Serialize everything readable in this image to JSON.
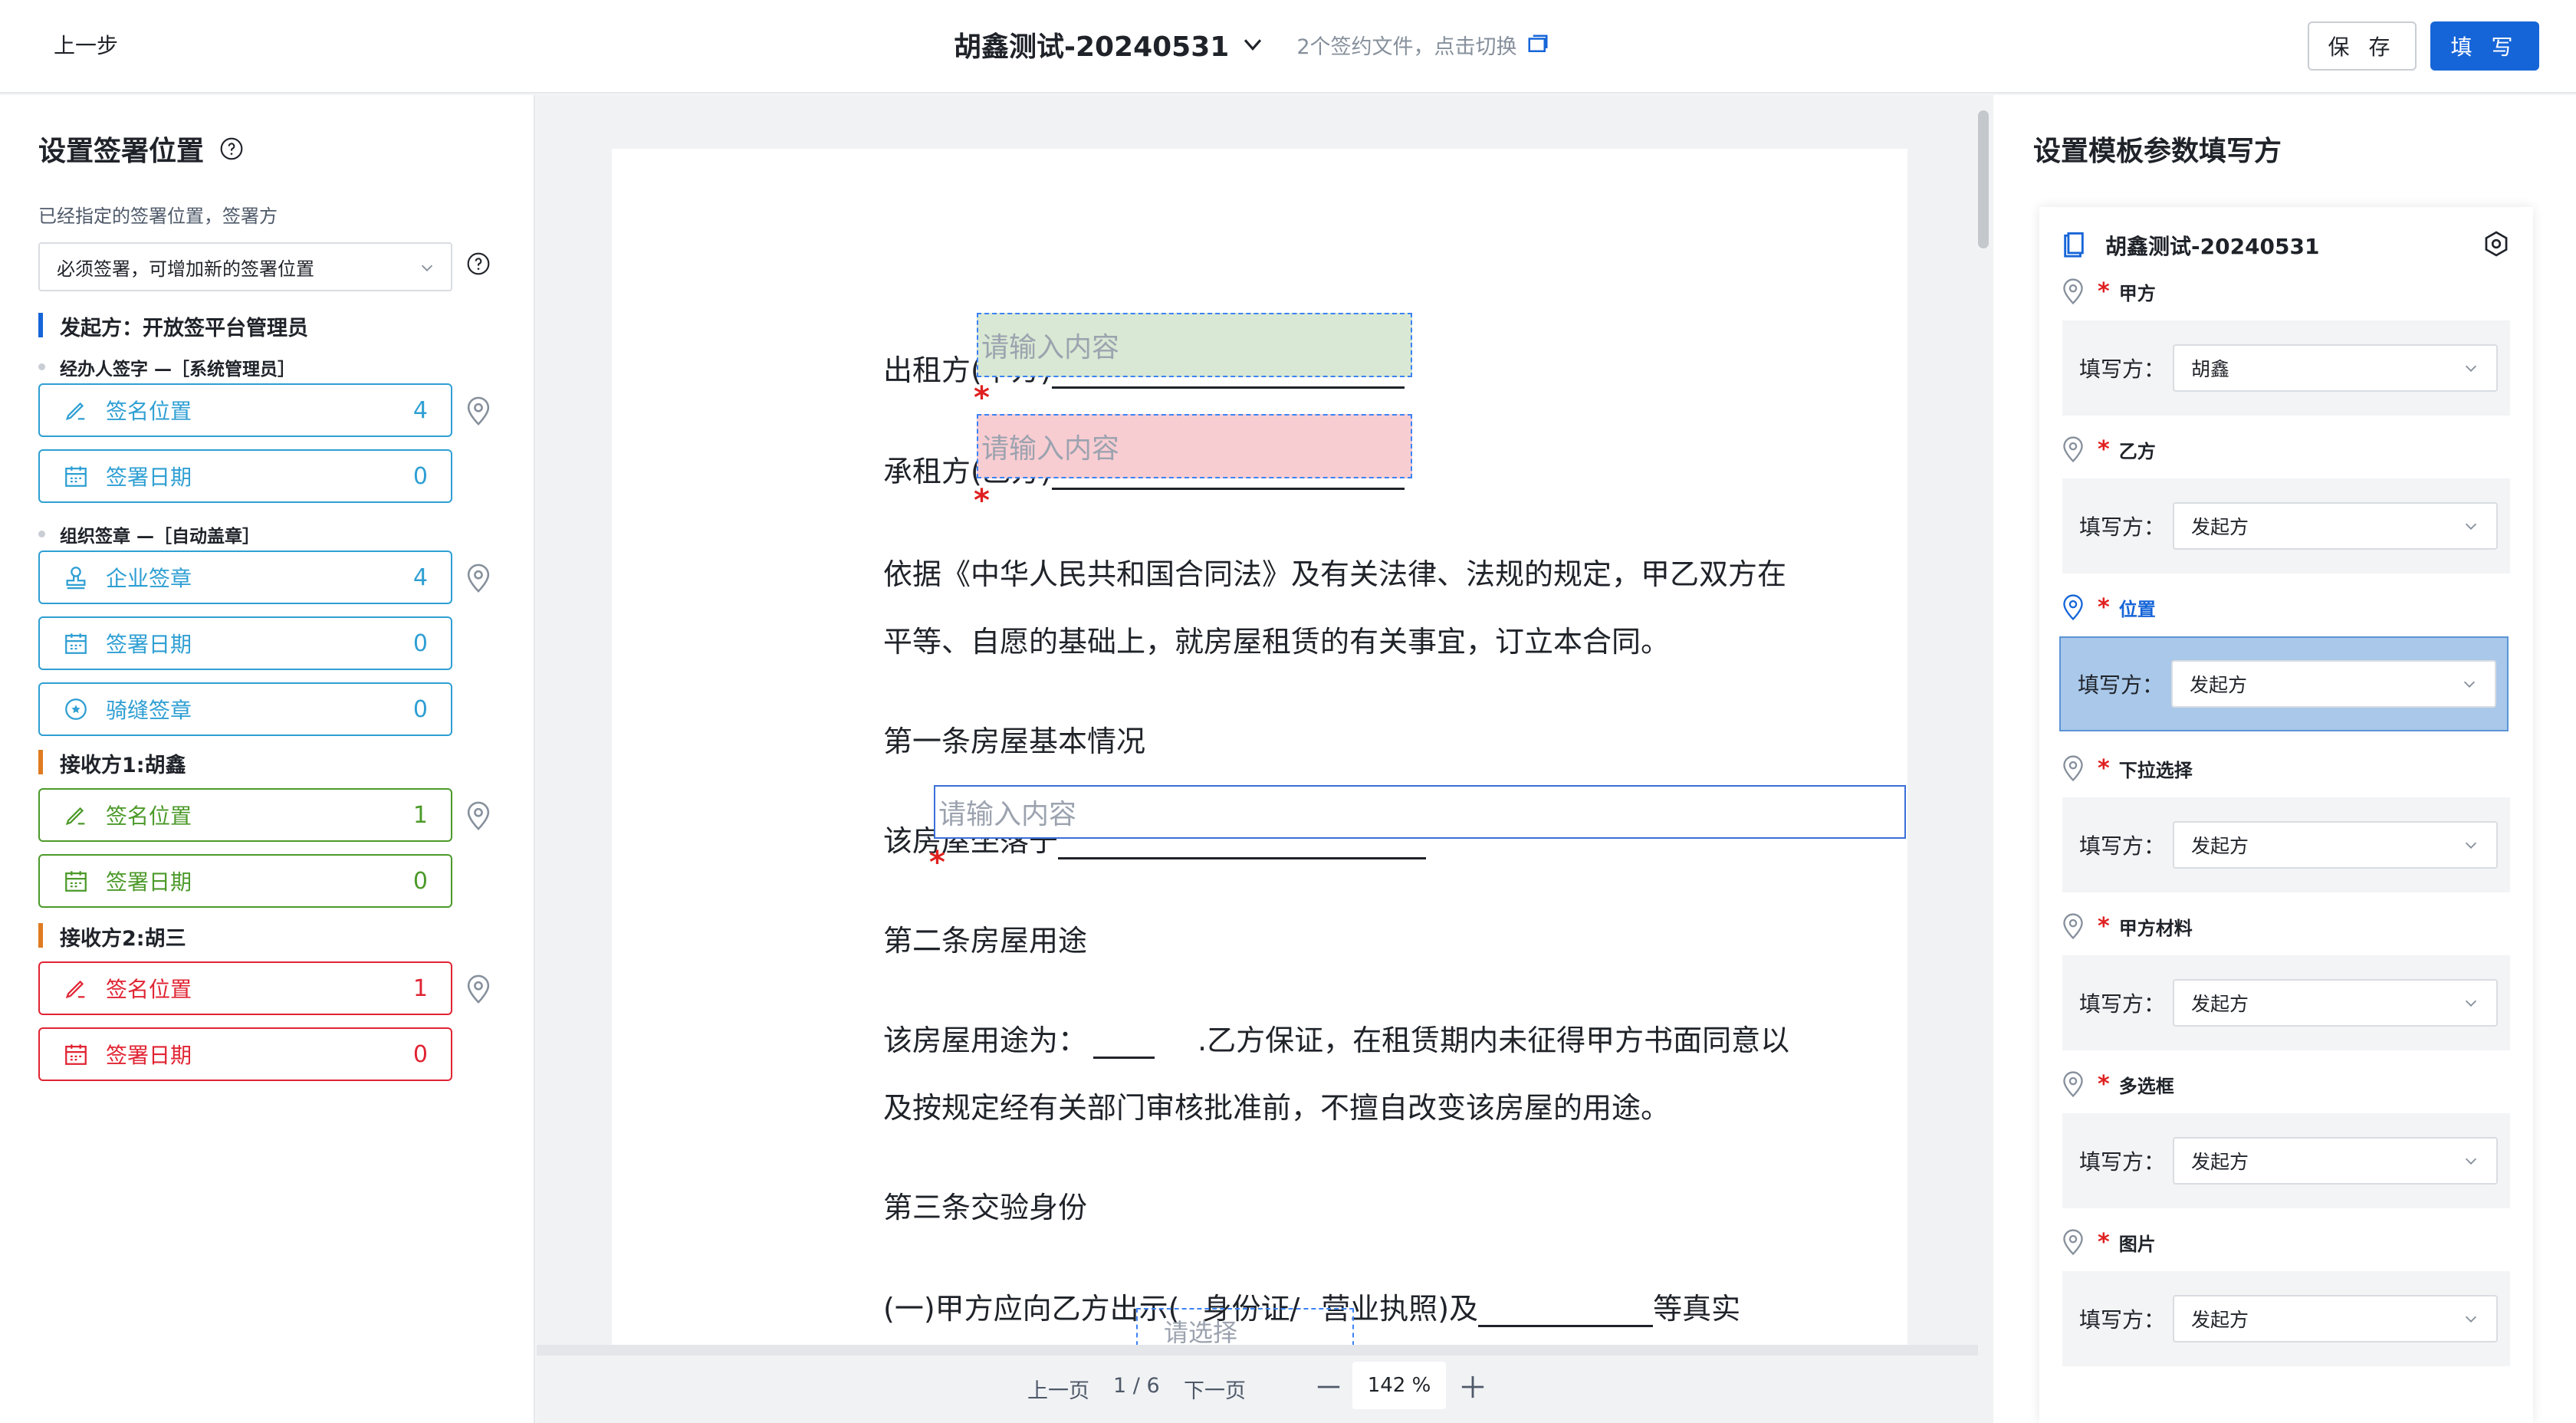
{
  "header": {
    "back_label": "上一步",
    "doc_title": "胡鑫测试-20240531",
    "switch_hint": "2个签约文件，点击切换",
    "save_label": "保 存",
    "fill_label": "填 写"
  },
  "left": {
    "title": "设置签署位置",
    "subtitle": "已经指定的签署位置，签署方",
    "select_value": "必须签署，可增加新的签署位置",
    "parties": [
      {
        "label": "发起方：开放签平台管理员",
        "groups": [
          {
            "label": "经办人签字 —［系统管理员］",
            "items": [
              {
                "label": "签名位置",
                "count": "4"
              },
              {
                "label": "签署日期",
                "count": "0"
              }
            ]
          },
          {
            "label": "组织签章 —［自动盖章］",
            "items": [
              {
                "label": "企业签章",
                "count": "4"
              },
              {
                "label": "签署日期",
                "count": "0"
              },
              {
                "label": "骑缝签章",
                "count": "0"
              }
            ]
          }
        ]
      },
      {
        "label": "接收方1:胡鑫",
        "items": [
          {
            "label": "签名位置",
            "count": "1"
          },
          {
            "label": "签署日期",
            "count": "0"
          }
        ]
      },
      {
        "label": "接收方2:胡三",
        "items": [
          {
            "label": "签名位置",
            "count": "1"
          },
          {
            "label": "签署日期",
            "count": "0"
          }
        ]
      }
    ]
  },
  "doc": {
    "line1": "出租方(甲方)",
    "line2": "承租方(乙方)",
    "line3": "依据《中华人民共和国合同法》及有关法律、法规的规定，甲乙双方在",
    "line4": "平等、自愿的基础上，就房屋租赁的有关事宜，订立本合同。",
    "line5": "第一条房屋基本情况",
    "line6": "该房屋坐落于",
    "line7": "第二条房屋用途",
    "line8a": "该房屋用途为：",
    "line8b": ".乙方保证，在租赁期内未征得甲方书面同意以",
    "line9": "及按规定经有关部门审核批准前，不擅自改变该房屋的用途。",
    "line10": "第三条交验身份",
    "line11a": "(一)甲方应向乙方出示(",
    "line11b": "身份证/",
    "line11c": "营业执照)及",
    "line11d": "等真实",
    "field_placeholder": "请输入内容",
    "select_placeholder": "请选择",
    "required_mark": "*"
  },
  "pager": {
    "prev": "上一页",
    "page": "1 / 6",
    "next": "下一页",
    "zoom": "142 %"
  },
  "right": {
    "title": "设置模板参数填写方",
    "card_title": "胡鑫测试-20240531",
    "filler_label": "填写方：",
    "params": [
      {
        "name": "甲方",
        "value": "胡鑫"
      },
      {
        "name": "乙方",
        "value": "发起方"
      },
      {
        "name": "位置",
        "value": "发起方"
      },
      {
        "name": "下拉选择",
        "value": "发起方"
      },
      {
        "name": "甲方材料",
        "value": "发起方"
      },
      {
        "name": "多选框",
        "value": "发起方"
      },
      {
        "name": "图片",
        "value": "发起方"
      }
    ]
  },
  "colors": {
    "primary": "#1665d8",
    "sender": "#2f9fd3",
    "receiver1": "#4c9a2a",
    "receiver2": "#e02433",
    "party_sender_bar": "#1665d8",
    "party_receiver_bar": "#e07b22"
  }
}
